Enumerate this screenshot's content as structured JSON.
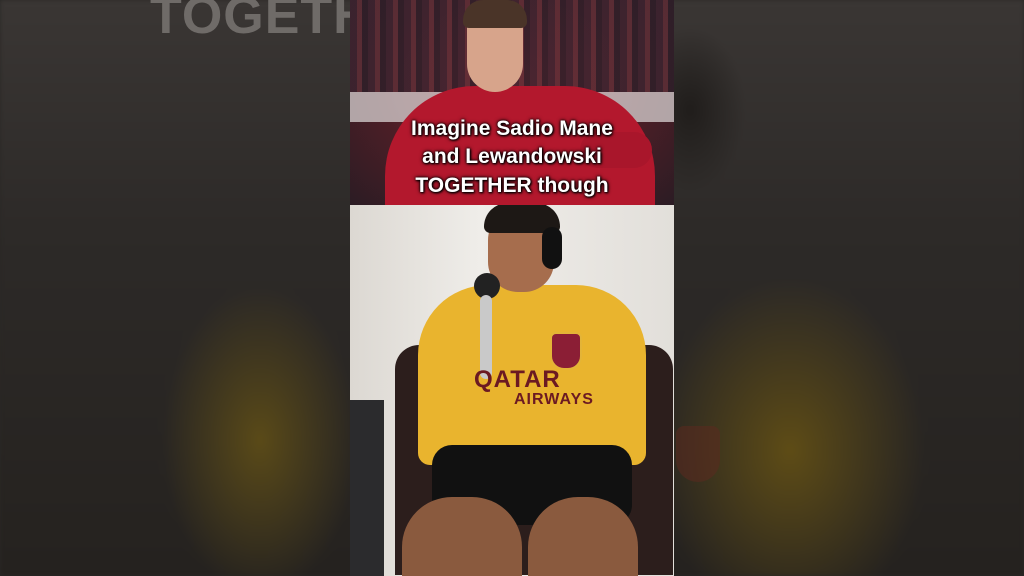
{
  "caption": {
    "line1": "Imagine Sadio Mane",
    "line2": "and Lewandowski",
    "line3": "TOGETHER though"
  },
  "background_caption": "TOGETHER though",
  "jersey_sponsor": {
    "line1": "QATAR",
    "line2": "AIRWAYS"
  }
}
